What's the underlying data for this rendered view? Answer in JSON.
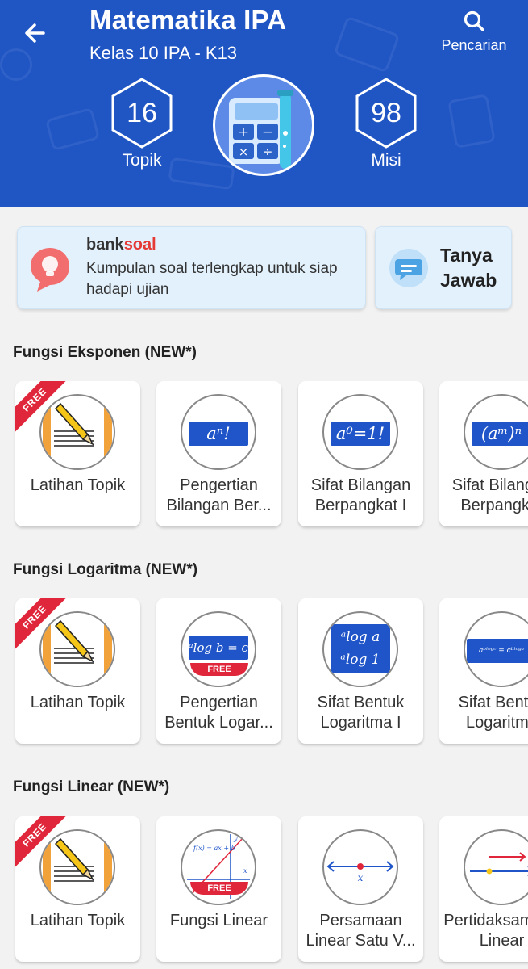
{
  "header": {
    "title": "Matematika IPA",
    "subtitle": "Kelas 10 IPA - K13",
    "search_label": "Pencarian",
    "topik_count": "16",
    "topik_label": "Topik",
    "misi_count": "98",
    "misi_label": "Misi"
  },
  "promos": {
    "bank_brand_a": "bank",
    "bank_brand_b": "soal",
    "bank_desc": "Kumpulan soal terlengkap untuk siap hadapi ujian",
    "tanya_label": "Tanya Jawab"
  },
  "sections": [
    {
      "title": "Fungsi Eksponen (NEW*)",
      "cards": [
        {
          "label": "Latihan Topik",
          "ribbon": "FREE"
        },
        {
          "label": "Pengertian Bilangan Ber...",
          "formula": "aⁿ!"
        },
        {
          "label": "Sifat Bilangan Berpangkat I",
          "formula": "a⁰=1!"
        },
        {
          "label": "Sifat Bilangan Berpangkat",
          "formula": "(aᵐ)ⁿ"
        }
      ]
    },
    {
      "title": "Fungsi Logaritma (NEW*)",
      "cards": [
        {
          "label": "Latihan Topik",
          "ribbon": "FREE"
        },
        {
          "label": "Pengertian Bentuk Logar...",
          "formula": "ᵃlog b = c",
          "strip": "FREE"
        },
        {
          "label": "Sifat Bentuk Logaritma I",
          "formula": "ᵃlog a",
          "formula2": "ᵃlog 1"
        },
        {
          "label": "Sifat Bentuk Logaritma",
          "formula": "aᵇˡᵒᵍᶜ = cᵇˡᵒᵍᵃ"
        }
      ]
    },
    {
      "title": "Fungsi Linear (NEW*)",
      "cards": [
        {
          "label": "Latihan Topik",
          "ribbon": "FREE"
        },
        {
          "label": "Fungsi Linear",
          "formula": "f(x) = ax + b",
          "axis_x": "x",
          "axis_y": "y",
          "strip": "FREE"
        },
        {
          "label": "Persamaan Linear Satu V...",
          "axis_x": "x"
        },
        {
          "label": "Pertidaksamaan Linear"
        }
      ]
    }
  ],
  "colors": {
    "header_bg": "#2055c4",
    "accent_red": "#e0263a",
    "promo_bg": "#e3f1fc"
  }
}
